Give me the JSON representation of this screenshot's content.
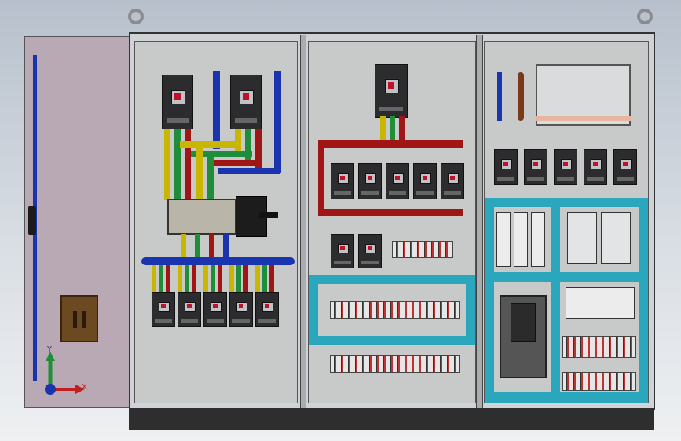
{
  "scene": {
    "title": "",
    "axis_triad": {
      "y_label": "Y",
      "x_label": "X"
    }
  },
  "colors": {
    "background_top": "#b7c0cc",
    "cabinet_frame": "#cfd3d6",
    "panel": "#c8c9c9",
    "door": "#b9a9b4",
    "busbar_yellow": "#c9b600",
    "busbar_green": "#1f8d3a",
    "busbar_red": "#a01515",
    "busbar_blue": "#1a34b0",
    "duct_teal": "#2aa7bd",
    "plinth": "#2e2e2e"
  },
  "icons": [
    "lifting-eye-icon",
    "axis-triad-icon",
    "door-handle-icon",
    "lock-plate-icon"
  ]
}
